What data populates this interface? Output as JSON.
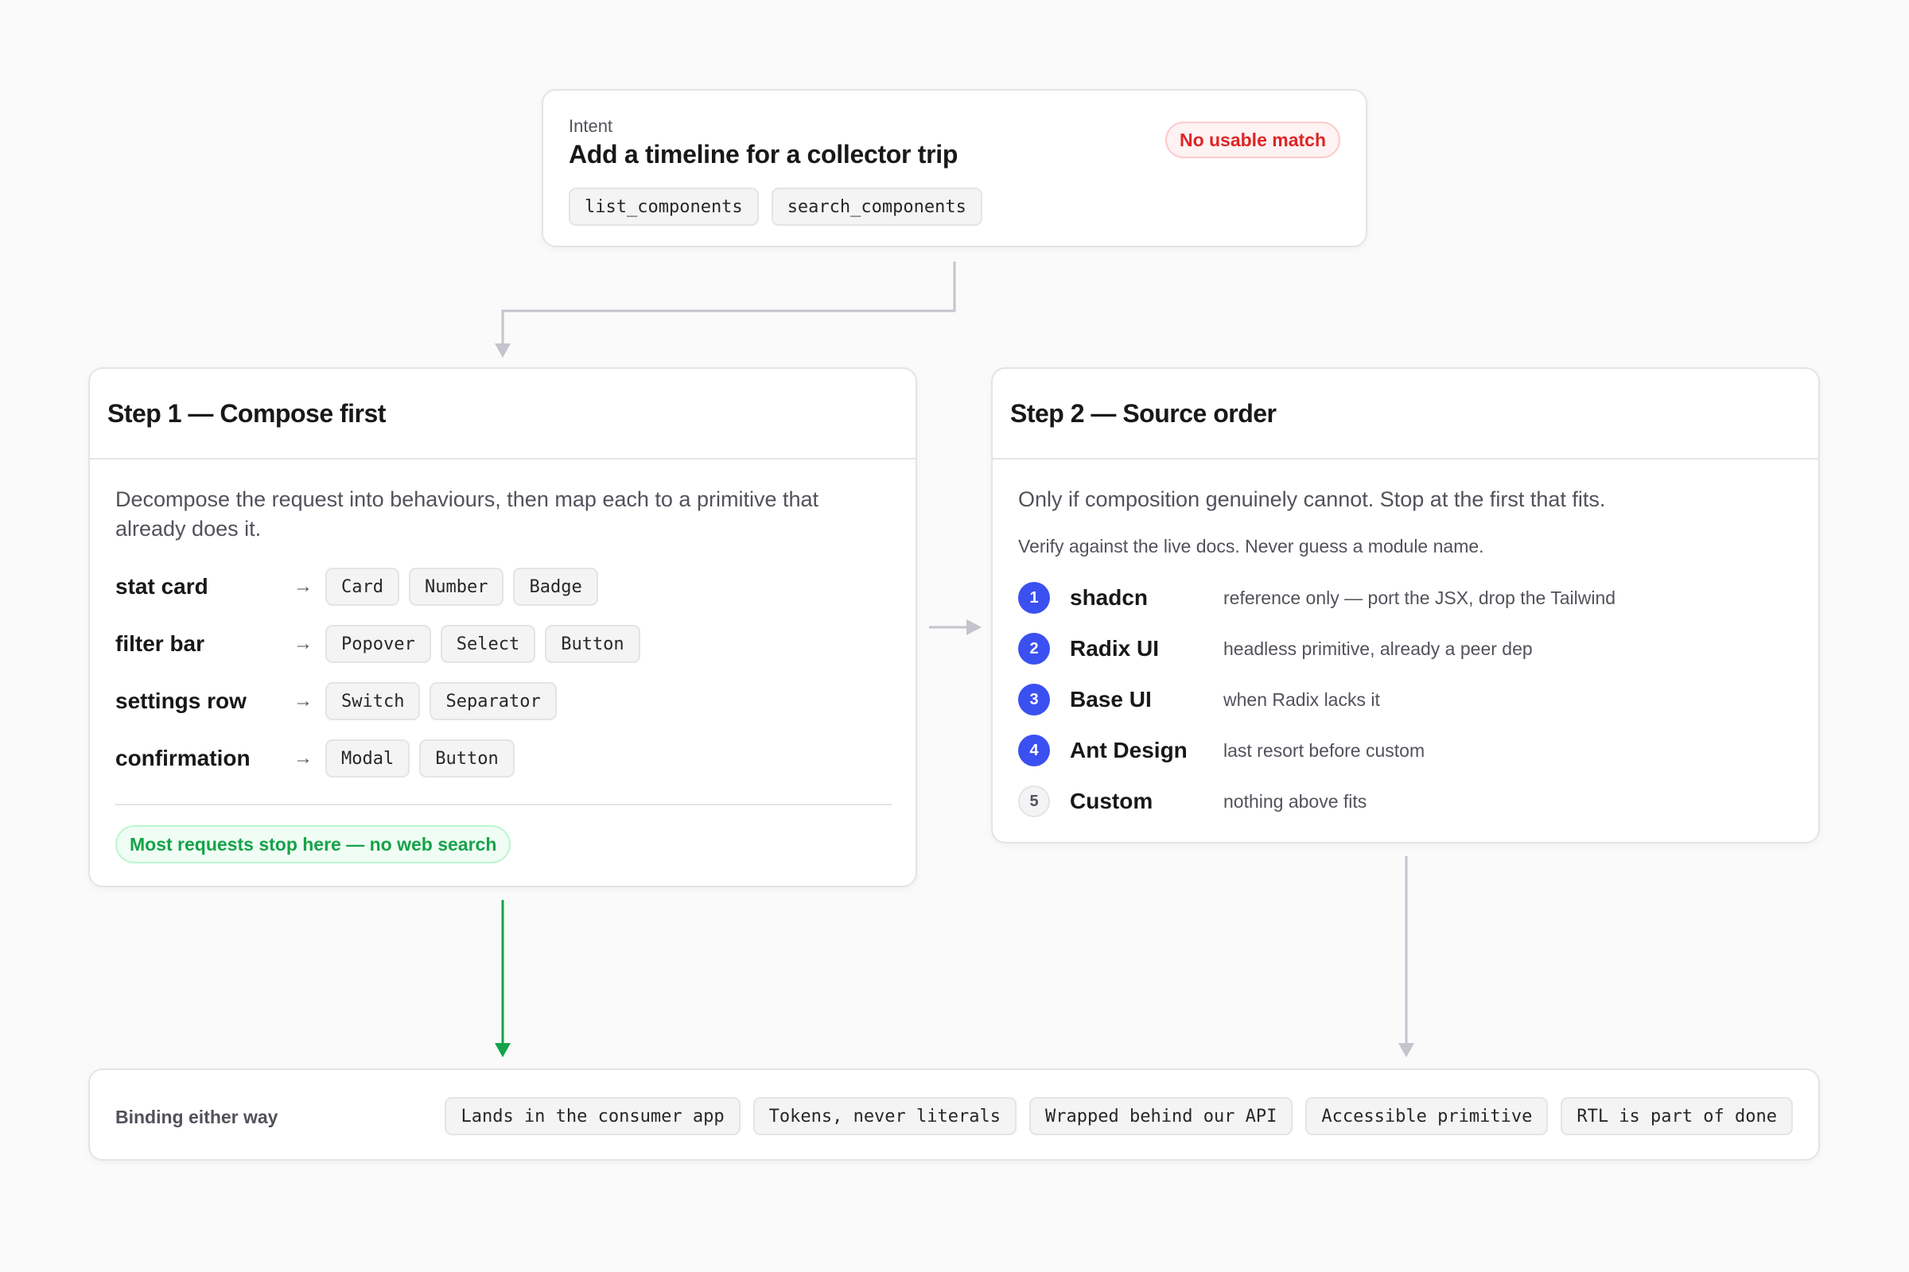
{
  "intent": {
    "eyebrow": "Intent",
    "title": "Add a timeline for a collector trip",
    "badge": "No usable match",
    "tools": [
      "list_components",
      "search_components"
    ]
  },
  "step1": {
    "title": "Step 1 — Compose first",
    "description": "Decompose the request into behaviours, then map each to a primitive that already does it.",
    "arrow_glyph": "→",
    "rows": [
      {
        "label": "stat card",
        "primitives": [
          "Card",
          "Number",
          "Badge"
        ]
      },
      {
        "label": "filter bar",
        "primitives": [
          "Popover",
          "Select",
          "Button"
        ]
      },
      {
        "label": "settings row",
        "primitives": [
          "Switch",
          "Separator"
        ]
      },
      {
        "label": "confirmation",
        "primitives": [
          "Modal",
          "Button"
        ]
      }
    ],
    "success_note": "Most requests stop here — no web search"
  },
  "step2": {
    "title": "Step 2 — Source order",
    "description": "Only if composition genuinely cannot. Stop at the first that fits.",
    "note": "Verify against the live docs. Never guess a module name.",
    "sources": [
      {
        "num": "1",
        "name": "shadcn",
        "desc": "reference only — port the JSX, drop the Tailwind"
      },
      {
        "num": "2",
        "name": "Radix UI",
        "desc": "headless primitive, already a peer dep"
      },
      {
        "num": "3",
        "name": "Base UI",
        "desc": "when Radix lacks it"
      },
      {
        "num": "4",
        "name": "Ant Design",
        "desc": "last resort before custom"
      },
      {
        "num": "5",
        "name": "Custom",
        "desc": "nothing above fits"
      }
    ]
  },
  "bottom": {
    "label": "Binding either way",
    "rules": [
      "Lands in the consumer app",
      "Tokens, never literals",
      "Wrapped behind our API",
      "Accessible primitive",
      "RTL is part of done"
    ]
  },
  "colors": {
    "accent": "#3b50f0",
    "success": "#16a34a",
    "danger": "#dc2626",
    "connector": "#c4c4cc"
  }
}
